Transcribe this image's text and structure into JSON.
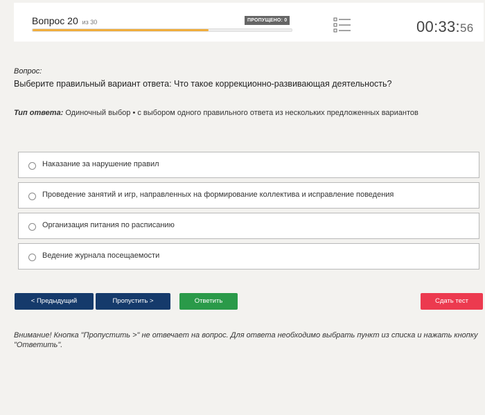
{
  "header": {
    "question_label": "Вопрос 20",
    "question_total": "из 30",
    "skipped_label": "ПРОПУЩЕНО: 0",
    "progress_fraction": 0.68,
    "progress_color": "#f0ad3c",
    "timer_main": "00:33:",
    "timer_seconds": "56",
    "list_icon": "list-icon"
  },
  "question": {
    "label": "Вопрос:",
    "text": "Выберите правильный вариант ответа: Что такое коррекционно-развивающая деятельность?"
  },
  "answer_type": {
    "label": "Тип ответа:",
    "value": "Одиночный выбор • с выбором одного правильного ответа из нескольких предложенных вариантов"
  },
  "options": [
    {
      "text": "Наказание за нарушение правил"
    },
    {
      "text": "Проведение занятий и игр, направленных на формирование коллектива и исправление поведения"
    },
    {
      "text": "Организация питания по расписанию"
    },
    {
      "text": "Ведение журнала посещаемости"
    }
  ],
  "buttons": {
    "prev": "< Предыдущий",
    "skip": "Пропустить >",
    "answer": "Ответить",
    "submit": "Сдать тест"
  },
  "colors": {
    "nav_button": "#153a6b",
    "answer_button": "#2a9a49",
    "submit_button": "#ec3a4f"
  },
  "notice": "Внимание! Кнопка \"Пропустить >\" не отвечает на вопрос. Для ответа необходимо выбрать пункт из списка и нажать кнопку \"Ответить\"."
}
